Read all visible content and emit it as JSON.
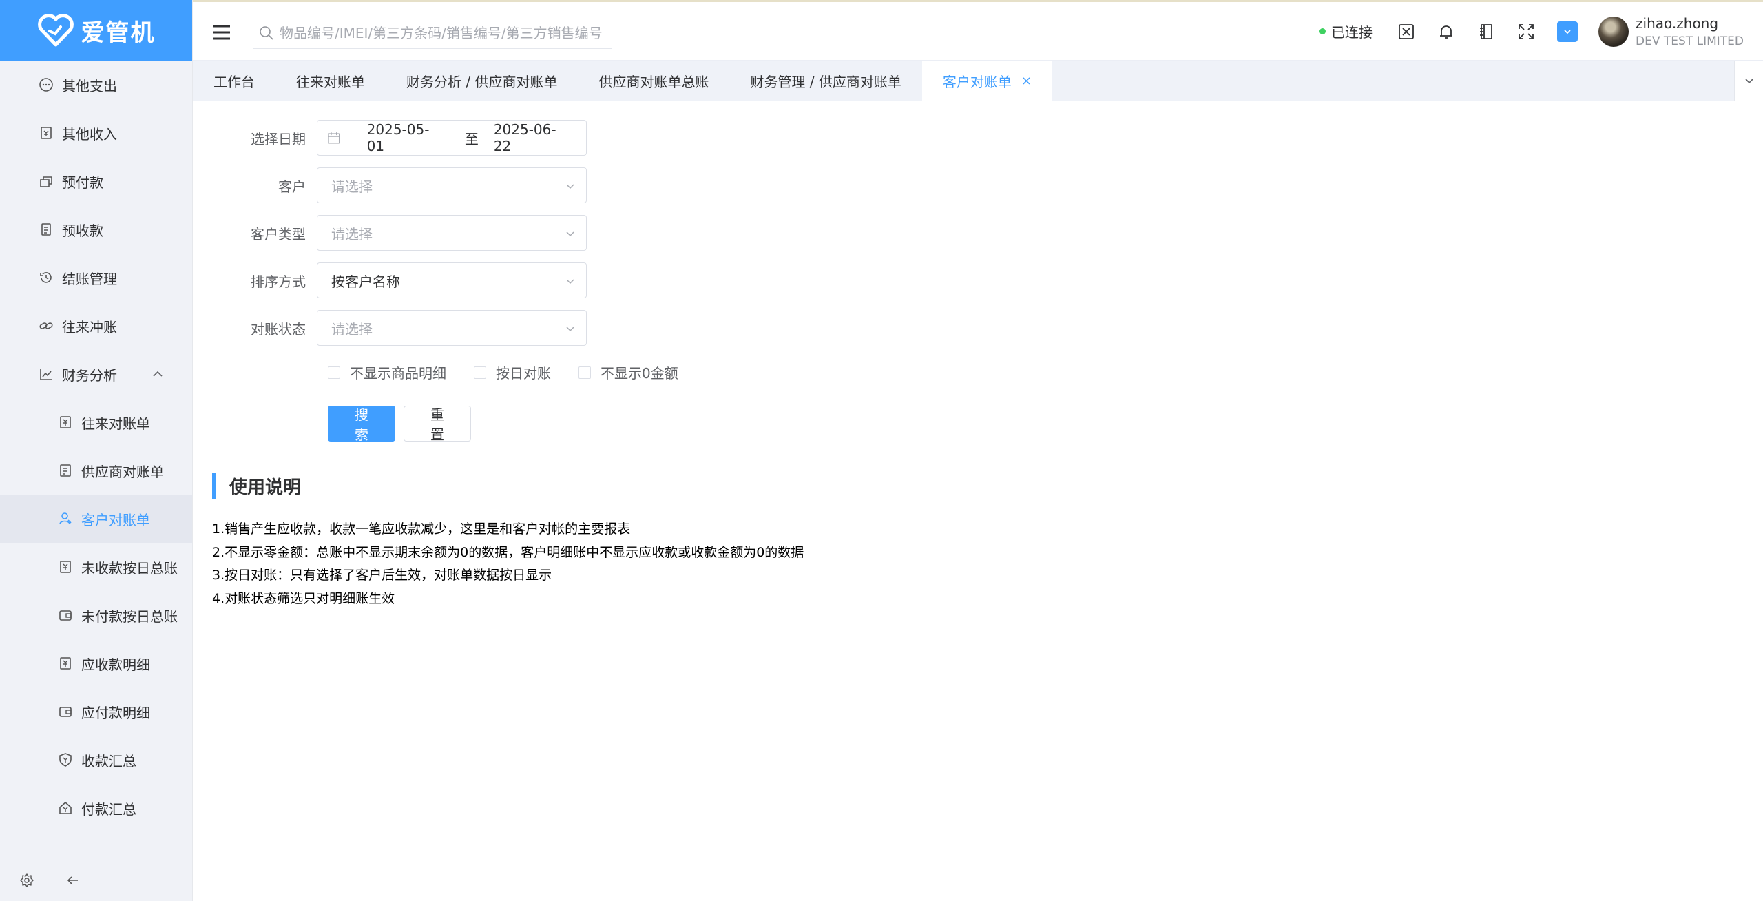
{
  "app": {
    "name": "爱管机"
  },
  "sidebar": {
    "items": [
      {
        "label": "其他支出",
        "icon": "dots-circle-icon"
      },
      {
        "label": "其他收入",
        "icon": "receipt-icon"
      },
      {
        "label": "预付款",
        "icon": "prepay-icon"
      },
      {
        "label": "预收款",
        "icon": "document-icon"
      },
      {
        "label": "结账管理",
        "icon": "history-icon"
      },
      {
        "label": "往来冲账",
        "icon": "link-icon"
      },
      {
        "label": "财务分析",
        "icon": "chart-icon",
        "expanded": true
      }
    ],
    "subitems": [
      {
        "label": "往来对账单",
        "icon": "yen-doc-icon"
      },
      {
        "label": "供应商对账单",
        "icon": "file-list-icon"
      },
      {
        "label": "客户对账单",
        "icon": "user-icon",
        "active": true
      },
      {
        "label": "未收款按日总账",
        "icon": "yen-doc-icon"
      },
      {
        "label": "未付款按日总账",
        "icon": "wallet-icon"
      },
      {
        "label": "应收款明细",
        "icon": "yen-doc-icon"
      },
      {
        "label": "应付款明细",
        "icon": "wallet-icon"
      },
      {
        "label": "收款汇总",
        "icon": "shield-yen-icon"
      },
      {
        "label": "付款汇总",
        "icon": "home-yen-icon"
      }
    ]
  },
  "header": {
    "search_placeholder": "物品编号/IMEI/第三方条码/销售编号/第三方销售编号",
    "connection_status": "已连接",
    "user_name": "zihao.zhong",
    "user_org": "DEV TEST LIMITED"
  },
  "tabs": [
    {
      "label": "工作台"
    },
    {
      "label": "往来对账单"
    },
    {
      "label": "财务分析 / 供应商对账单"
    },
    {
      "label": "供应商对账单总账"
    },
    {
      "label": "财务管理 / 供应商对账单"
    },
    {
      "label": "客户对账单",
      "active": true,
      "close": "×"
    }
  ],
  "form": {
    "date_label": "选择日期",
    "date_start": "2025-05-01",
    "date_sep": "至",
    "date_end": "2025-06-22",
    "customer_label": "客户",
    "customer_placeholder": "请选择",
    "customer_type_label": "客户类型",
    "customer_type_placeholder": "请选择",
    "sort_label": "排序方式",
    "sort_value": "按客户名称",
    "status_label": "对账状态",
    "status_placeholder": "请选择",
    "checkboxes": [
      "不显示商品明细",
      "按日对账",
      "不显示0金额"
    ],
    "search_button": "搜索",
    "reset_button": "重置"
  },
  "usage": {
    "title": "使用说明",
    "lines": [
      "1.销售产生应收款，收款一笔应收款减少，这里是和客户对帐的主要报表",
      "2.不显示零金额：总账中不显示期末余额为0的数据，客户明细账中不显示应收款或收款金额为0的数据",
      "3.按日对账：只有选择了客户后生效，对账单数据按日显示",
      "4.对账状态筛选只对明细账生效"
    ]
  },
  "colors": {
    "primary": "#409eff",
    "connected": "#3ed161"
  }
}
